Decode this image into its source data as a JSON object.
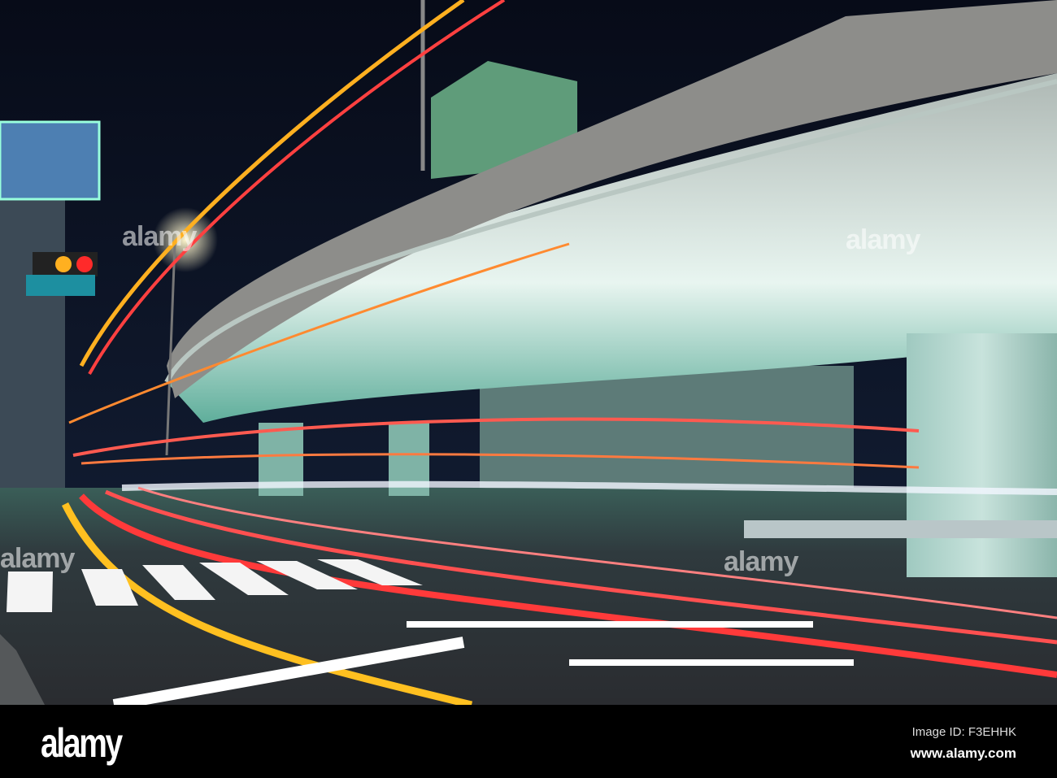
{
  "photo": {
    "subject": "night elevated highway with light trails",
    "watermark_text": "alamy"
  },
  "footer": {
    "logo": "alamy",
    "image_id": "Image ID: F3EHHK",
    "url": "www.alamy.com"
  },
  "colors": {
    "sky": "#0a0f1f",
    "concrete": "#8d8d8a",
    "underside": "#cfe6df",
    "trail_red": "#ff3a3a",
    "trail_orange": "#ffb020",
    "road": "#2e3236"
  }
}
